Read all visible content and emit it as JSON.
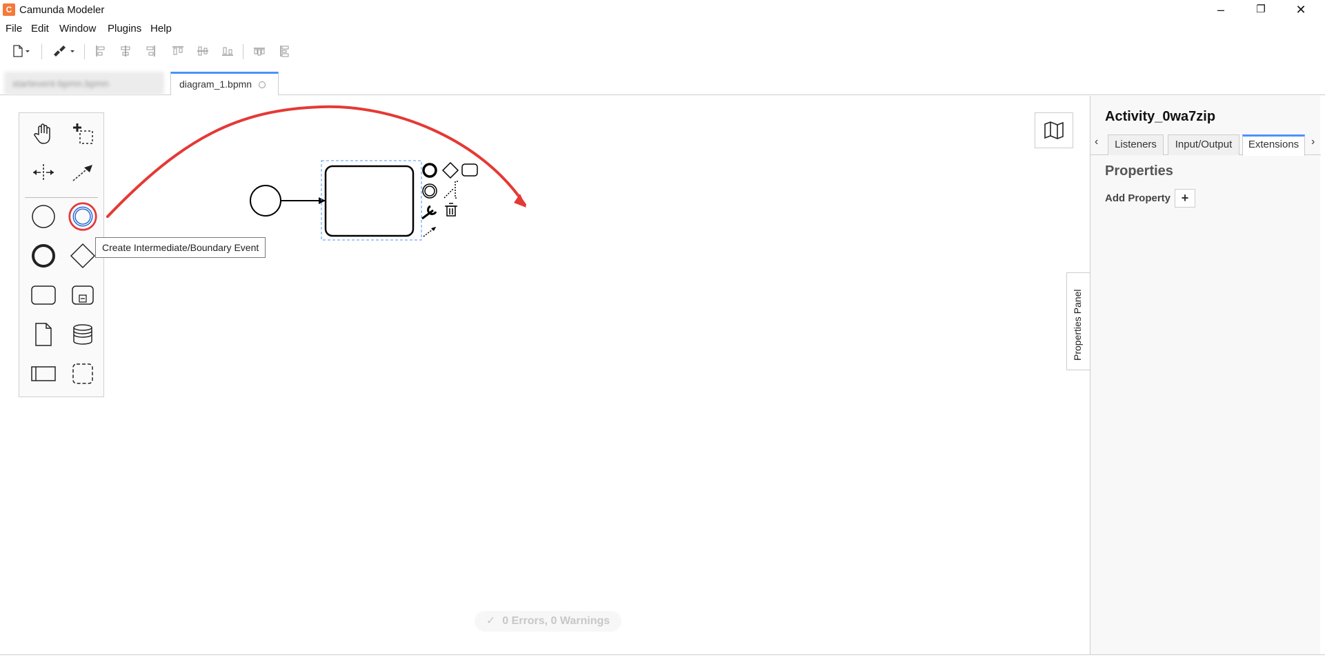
{
  "window": {
    "title": "Camunda Modeler",
    "app_icon_glyph": "C",
    "minimize": "–",
    "maximize": "❐",
    "close": "✕"
  },
  "menu": [
    "File",
    "Edit",
    "Window",
    "Plugins",
    "Help"
  ],
  "toolbar": {
    "icons": [
      "new-file-icon",
      "dropdown-caret-icon",
      "paint-brush-icon",
      "align-left-icon",
      "align-center-icon",
      "align-right-icon",
      "align-top-icon",
      "align-middle-icon",
      "align-bottom-icon",
      "distribute-horizontal-icon",
      "distribute-vertical-icon"
    ]
  },
  "tabs": {
    "inactive_label": "startevent-bpmn.bpmn",
    "active_label": "diagram_1.bpmn"
  },
  "palette": {
    "tools": [
      "hand-tool-icon",
      "lasso-tool-icon",
      "space-tool-icon",
      "global-connect-icon",
      "start-event-icon",
      "intermediate-event-icon",
      "end-event-icon",
      "gateway-icon",
      "task-icon",
      "subprocess-icon",
      "data-object-icon",
      "data-store-icon",
      "participant-icon",
      "group-icon"
    ]
  },
  "tooltip": "Create Intermediate/Boundary Event",
  "status": "0 Errors, 0 Warnings",
  "status_icon": "check-icon",
  "properties_toggle": "Properties Panel",
  "properties": {
    "element_id": "Activity_0wa7zip",
    "tabs": [
      "Listeners",
      "Input/Output",
      "Extensions"
    ],
    "active_tab": "Extensions",
    "section_title": "Properties",
    "add_label": "Add Property",
    "add_button": "+"
  },
  "colors": {
    "accent": "#4d90fe",
    "highlight_red": "#e53935",
    "selection": "#4d90fe"
  }
}
